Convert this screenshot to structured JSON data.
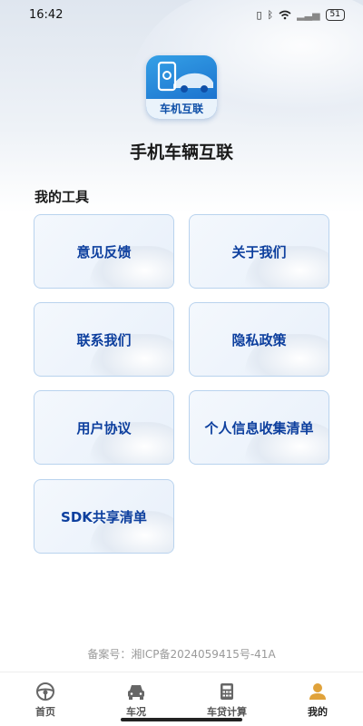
{
  "status_bar": {
    "time": "16:42",
    "battery": "51"
  },
  "app": {
    "logo_text": "车机互联",
    "title": "手机车辆互联"
  },
  "section": {
    "title": "我的工具"
  },
  "tools": [
    {
      "label": "意见反馈"
    },
    {
      "label": "关于我们"
    },
    {
      "label": "联系我们"
    },
    {
      "label": "隐私政策"
    },
    {
      "label": "用户协议"
    },
    {
      "label": "个人信息收集清单"
    },
    {
      "label": "SDK共享清单"
    }
  ],
  "footer": {
    "icp": "备案号：湘ICP备2024059415号-41A"
  },
  "tabs": [
    {
      "label": "首页",
      "icon": "steering-wheel-icon"
    },
    {
      "label": "车况",
      "icon": "car-icon"
    },
    {
      "label": "车贷计算",
      "icon": "calculator-icon"
    },
    {
      "label": "我的",
      "icon": "user-icon",
      "active": true
    }
  ],
  "colors": {
    "accent": "#0d3f9e",
    "card_border": "#b9d3ee",
    "active_tab": "#e0a23a"
  }
}
